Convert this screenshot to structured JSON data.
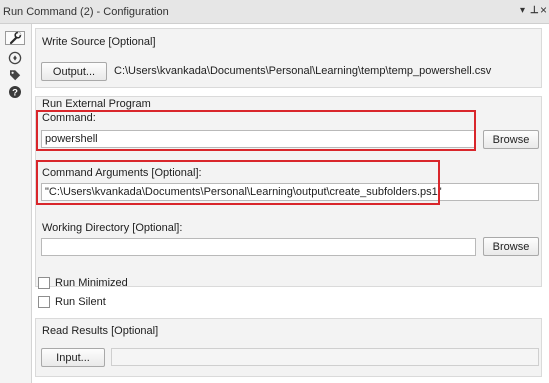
{
  "window": {
    "title": "Run Command (2) - Configuration",
    "controls": {
      "dropdown": "▾",
      "pin": "⊥",
      "close": "×"
    }
  },
  "sidebar": {
    "icons": [
      "wrench-icon",
      "navigate-icon",
      "tag-icon",
      "help-icon"
    ]
  },
  "write_source": {
    "label": "Write Source [Optional]",
    "button_label": "Output...",
    "path": "C:\\Users\\kvankada\\Documents\\Personal\\Learning\\temp\\temp_powershell.csv"
  },
  "run_external": {
    "label": "Run External Program",
    "command_label": "Command:",
    "command_value": "powershell",
    "browse_label": "Browse",
    "args_label": "Command Arguments [Optional]:",
    "args_value": "\"C:\\Users\\kvankada\\Documents\\Personal\\Learning\\output\\create_subfolders.ps1\"",
    "workdir_label": "Working Directory [Optional]:",
    "workdir_value": "",
    "workdir_browse_label": "Browse"
  },
  "options": {
    "run_minimized_label": "Run Minimized",
    "run_minimized_checked": false,
    "run_silent_label": "Run Silent",
    "run_silent_checked": false
  },
  "read_results": {
    "label": "Read Results [Optional]",
    "button_label": "Input...",
    "value": ""
  },
  "colors": {
    "highlight": "#d9262b",
    "background": "#ffffff",
    "panel": "#f3f3f3"
  }
}
